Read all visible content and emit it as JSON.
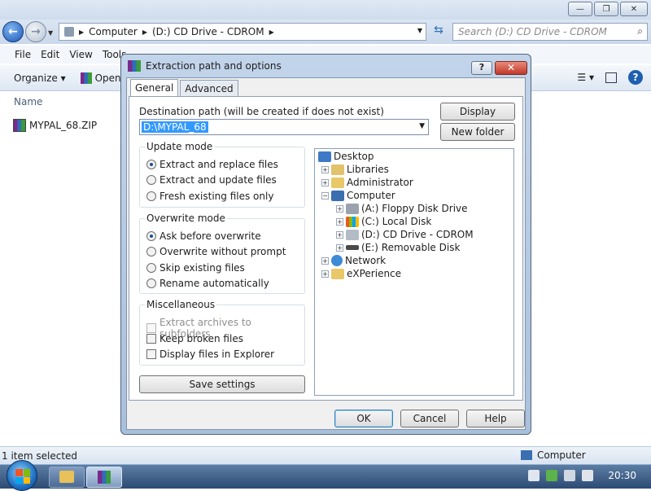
{
  "explorer": {
    "address": {
      "parts": [
        "Computer",
        "(D:) CD Drive - CDROM"
      ]
    },
    "search_placeholder": "Search (D:) CD Drive - CDROM",
    "menu": [
      "File",
      "Edit",
      "View",
      "Tools"
    ],
    "commands": {
      "organize": "Organize",
      "open": "Open"
    },
    "column_name": "Name",
    "files": [
      {
        "name": "MYPAL_68.ZIP"
      }
    ],
    "status_left": "1 item selected",
    "status_right": "Computer"
  },
  "dialog": {
    "title": "Extraction path and options",
    "tabs": [
      "General",
      "Advanced"
    ],
    "dest_label": "Destination path (will be created if does not exist)",
    "dest_value": "D:\\MYPAL_68",
    "display_button": "Display",
    "new_folder_button": "New folder",
    "update_mode": {
      "label": "Update mode",
      "options": [
        "Extract and replace files",
        "Extract and update files",
        "Fresh existing files only"
      ],
      "selected": 0
    },
    "overwrite_mode": {
      "label": "Overwrite mode",
      "options": [
        "Ask before overwrite",
        "Overwrite without prompt",
        "Skip existing files",
        "Rename automatically"
      ],
      "selected": 0
    },
    "misc": {
      "label": "Miscellaneous",
      "options": [
        "Extract archives to subfolders",
        "Keep broken files",
        "Display files in Explorer"
      ],
      "disabled": [
        true,
        false,
        false
      ],
      "checked": [
        false,
        false,
        false
      ]
    },
    "save_settings": "Save settings",
    "tree": [
      {
        "label": "Desktop"
      },
      {
        "label": "Libraries"
      },
      {
        "label": "Administrator"
      },
      {
        "label": "Computer"
      },
      {
        "label": "(A:) Floppy Disk Drive"
      },
      {
        "label": "(C:) Local Disk"
      },
      {
        "label": "(D:) CD Drive - CDROM"
      },
      {
        "label": "(E:) Removable Disk"
      },
      {
        "label": "Network"
      },
      {
        "label": "eXPerience"
      }
    ],
    "ok": "OK",
    "cancel": "Cancel",
    "help": "Help"
  },
  "taskbar": {
    "clock": "20:30"
  },
  "colors": {
    "accent": "#3399ff",
    "close": "#c0392b",
    "taskbar": "#2c4b74"
  }
}
